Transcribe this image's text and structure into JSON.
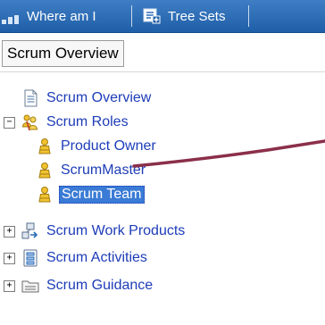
{
  "tabs": [
    {
      "label": "Where am I"
    },
    {
      "label": "Tree Sets"
    }
  ],
  "breadcrumb": {
    "label": "Scrum Overview"
  },
  "tree": {
    "items": [
      {
        "label": "Scrum Overview",
        "icon": "document-icon",
        "expander": ""
      },
      {
        "label": "Scrum Roles",
        "icon": "roles-group-icon",
        "expander": "−"
      },
      {
        "label": "Product Owner",
        "icon": "role-icon",
        "expander": ""
      },
      {
        "label": "ScrumMaster",
        "icon": "role-icon",
        "expander": ""
      },
      {
        "label": "Scrum Team",
        "icon": "role-icon",
        "expander": "",
        "selected": true
      },
      {
        "label": "Scrum Work Products",
        "icon": "work-products-icon",
        "expander": "+"
      },
      {
        "label": "Scrum Activities",
        "icon": "activities-icon",
        "expander": "+"
      },
      {
        "label": "Scrum Guidance",
        "icon": "guidance-folder-icon",
        "expander": "+"
      }
    ]
  },
  "colors": {
    "tab_bar": "#2a6bb8",
    "link_text": "#1d3cb8",
    "selection": "#3a7bd5",
    "annotation_arrow": "#8b2f4a"
  }
}
